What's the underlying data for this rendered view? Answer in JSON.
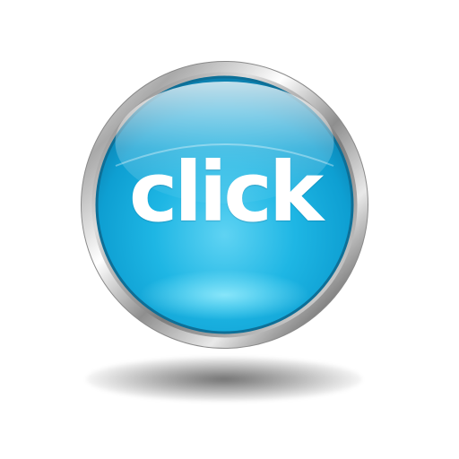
{
  "button": {
    "label": "click",
    "color": "#1fb2e0",
    "text_color": "#ffffff",
    "rim_color": "#c8c8c8"
  }
}
